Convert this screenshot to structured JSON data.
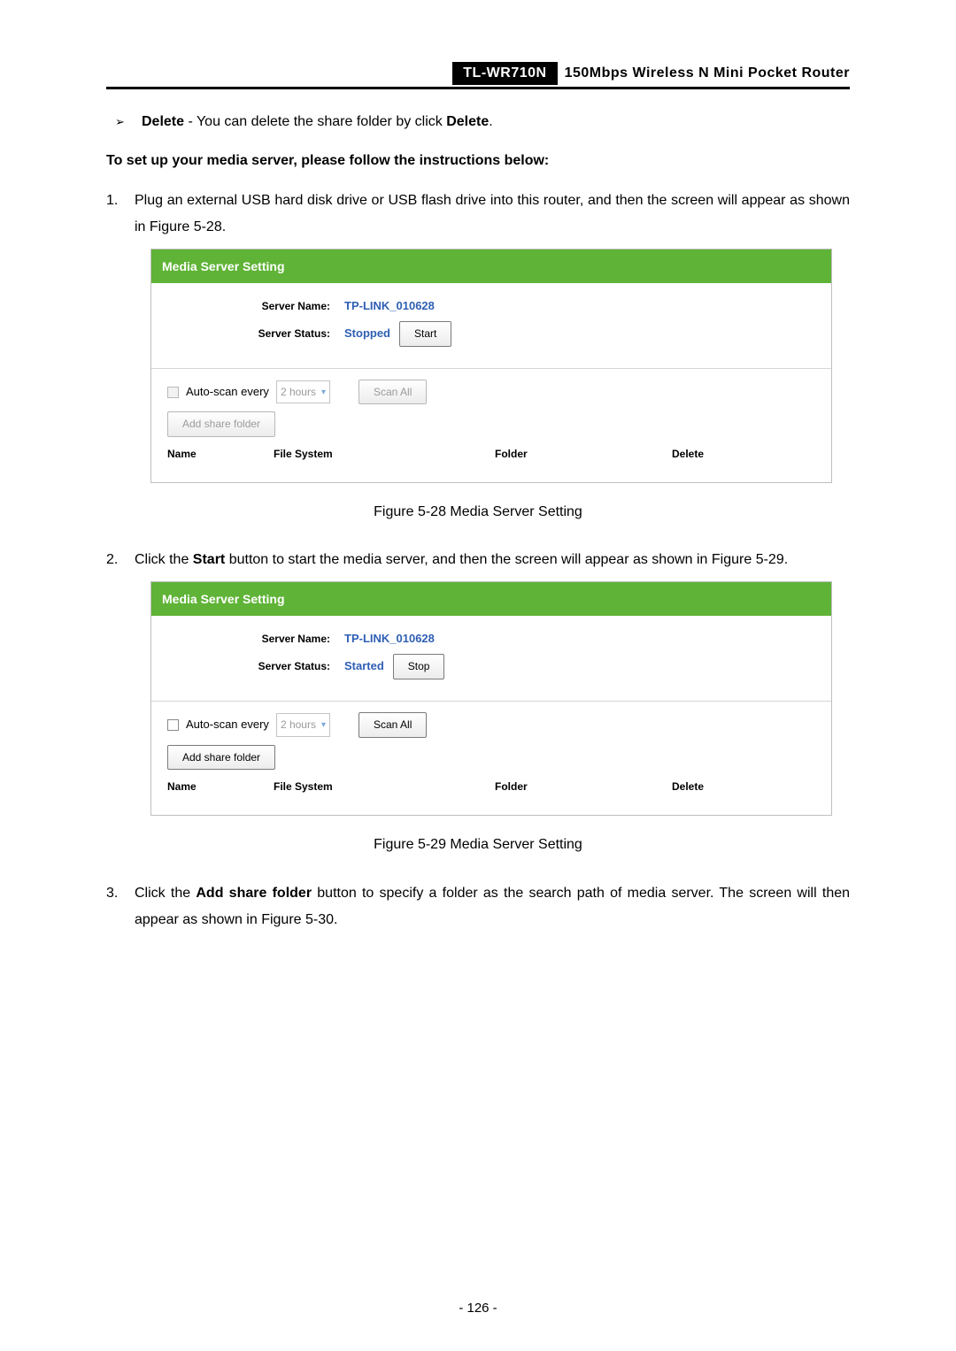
{
  "header": {
    "model": "TL-WR710N",
    "description": "150Mbps Wireless N Mini Pocket Router"
  },
  "bullet": {
    "label": "Delete",
    "text": " - You can delete the share folder by click ",
    "label2": "Delete",
    "period": "."
  },
  "setup_heading": "To set up your media server, please follow the instructions below:",
  "steps": {
    "s1": {
      "num": "1.",
      "text_a": "Plug an external USB hard disk drive or USB flash drive into this router, and then the screen will appear as shown in ",
      "fig_ref": "Figure 5-28",
      "text_b": "."
    },
    "s2": {
      "num": "2.",
      "text_a": "Click the ",
      "btn": "Start",
      "text_b": " button to start the media server, and then the screen will appear as shown in ",
      "fig_ref": "Figure 5-29",
      "text_c": "."
    },
    "s3": {
      "num": "3.",
      "text_a": "Click the ",
      "btn": "Add share folder",
      "text_b": " button to specify a folder as the search path of media server. The screen will then appear as shown in ",
      "fig_ref": "Figure 5-30",
      "text_c": "."
    }
  },
  "shot1": {
    "title": "Media Server Setting",
    "server_name_label": "Server Name:",
    "server_name_value": "TP-LINK_010628",
    "server_status_label": "Server Status:",
    "server_status_value": "Stopped",
    "action_btn": "Start",
    "auto_scan_label": "Auto-scan every",
    "auto_scan_value": "2 hours",
    "scan_all_btn": "Scan All",
    "add_share_btn": "Add share folder",
    "th_name": "Name",
    "th_fs": "File System",
    "th_folder": "Folder",
    "th_delete": "Delete"
  },
  "caption1": "Figure 5-28 Media Server Setting",
  "shot2": {
    "title": "Media Server Setting",
    "server_name_label": "Server Name:",
    "server_name_value": "TP-LINK_010628",
    "server_status_label": "Server Status:",
    "server_status_value": "Started",
    "action_btn": "Stop",
    "auto_scan_label": "Auto-scan every",
    "auto_scan_value": "2 hours",
    "scan_all_btn": "Scan All",
    "add_share_btn": "Add share folder",
    "th_name": "Name",
    "th_fs": "File System",
    "th_folder": "Folder",
    "th_delete": "Delete"
  },
  "caption2": "Figure 5-29 Media Server Setting",
  "page_number": "- 126 -"
}
